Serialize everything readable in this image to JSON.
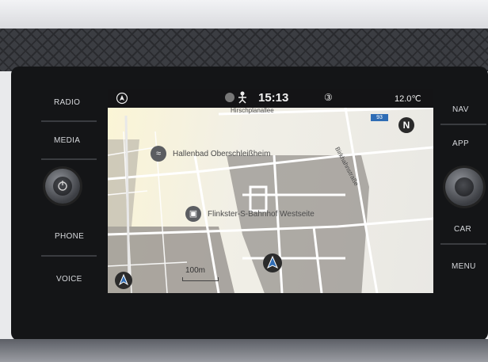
{
  "statusbar": {
    "time": "15:13",
    "badge": "③",
    "temperature": "12.0℃"
  },
  "map": {
    "streets": {
      "hirschplanallee": "Hirschplanallee",
      "birkhahnstrasse": "Birkhahnstraße",
      "route_badge": "93"
    },
    "pois": [
      {
        "label": "Hallenbad Oberschleißheim",
        "icon": "swimming-icon"
      },
      {
        "label": "Flinkster-S-Bahnhof Westseite",
        "icon": "car-sharing-icon"
      }
    ],
    "compass": "N",
    "scale": "100m"
  },
  "hardware": {
    "left": [
      "RADIO",
      "MEDIA",
      "PHONE",
      "VOICE"
    ],
    "right": [
      "NAV",
      "APP",
      "CAR",
      "MENU"
    ]
  },
  "colors": {
    "bezel": "#141517",
    "accent": "#2f6db5"
  }
}
